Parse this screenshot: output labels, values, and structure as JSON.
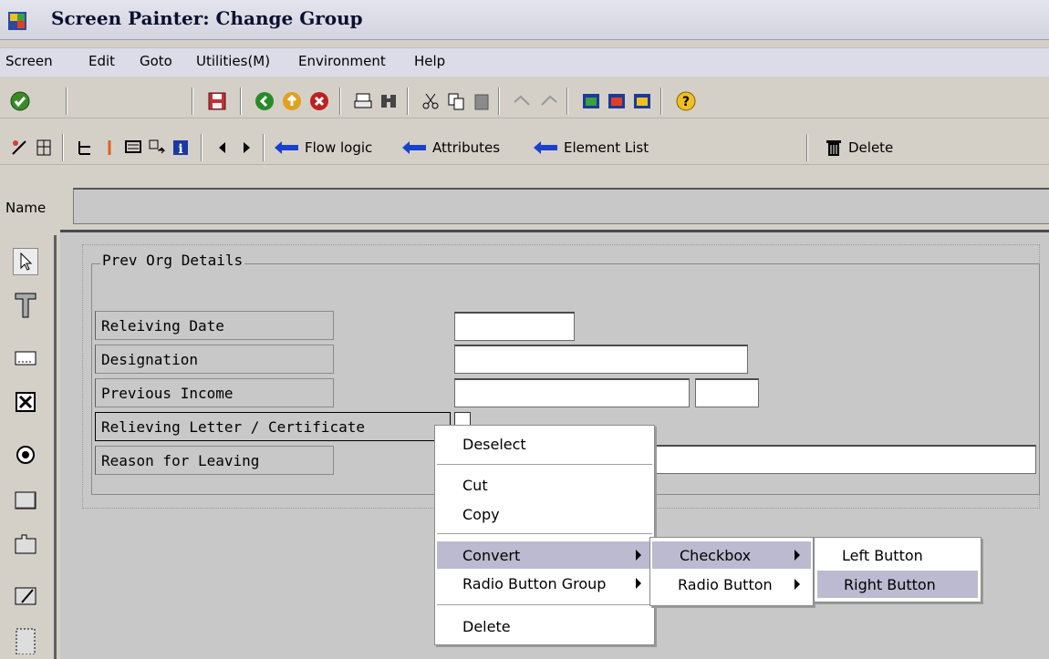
{
  "window": {
    "title": "Screen Painter: Change Group"
  },
  "menubar": {
    "items": [
      "Screen",
      "Edit",
      "Goto",
      "Utilities(M)",
      "Environment",
      "Help"
    ]
  },
  "toolbar2": {
    "flow_logic": "Flow logic",
    "attributes": "Attributes",
    "element_list": "Element List",
    "delete": "Delete"
  },
  "name_field": {
    "label": "Name",
    "value": ""
  },
  "group": {
    "title": "Prev Org Details"
  },
  "form": {
    "labels": [
      "Releiving Date",
      "Designation",
      "Previous Income",
      "Relieving Letter / Certificate",
      "Reason for Leaving"
    ]
  },
  "context_menu": {
    "deselect": "Deselect",
    "cut": "Cut",
    "copy": "Copy",
    "convert": "Convert",
    "radio_group": "Radio Button Group",
    "delete": "Delete"
  },
  "submenu1": {
    "checkbox": "Checkbox",
    "radio": "Radio Button"
  },
  "submenu2": {
    "left": "Left Button",
    "right": "Right Button"
  },
  "colors": {
    "menu_highlight": "#bcbad0",
    "background": "#d4d0c8",
    "canvas": "#c8c8c8"
  }
}
